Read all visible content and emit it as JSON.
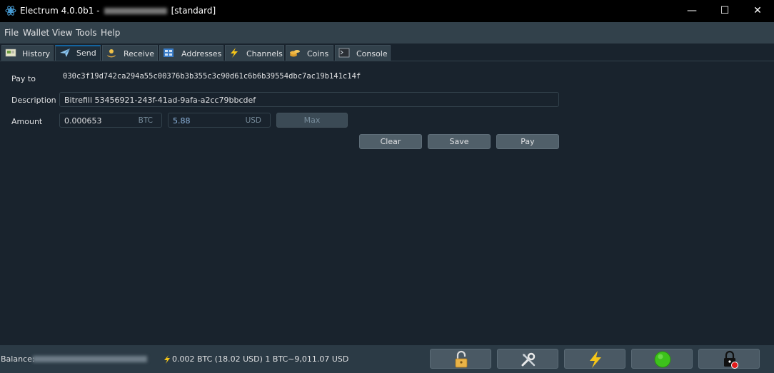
{
  "window": {
    "app_title": "Electrum 4.0.0b1  -",
    "wallet_type": "[standard]",
    "minimize": "—",
    "maximize": "☐",
    "close": "✕"
  },
  "menu": [
    "File",
    "Wallet",
    "View",
    "Tools",
    "Help"
  ],
  "tabs": [
    "History",
    "Send",
    "Receive",
    "Addresses",
    "Channels",
    "Coins",
    "Console"
  ],
  "active_tab": "Send",
  "send": {
    "payto_label": "Pay to",
    "payto_value": "030c3f19d742ca294a55c00376b3b355c3c90d61c6b6b39554dbc7ac19b141c14f",
    "description_label": "Description",
    "description_value": "Bitrefill 53456921-243f-41ad-9afa-a2cc79bbcdef",
    "amount_label": "Amount",
    "amount_btc": "0.000653",
    "amount_btc_unit": "BTC",
    "amount_fiat": "5.88",
    "amount_fiat_unit": "USD",
    "max_label": "Max",
    "clear_label": "Clear",
    "save_label": "Save",
    "pay_label": "Pay"
  },
  "status": {
    "balance_label": "Balance:",
    "lightning_balance": "0.002 BTC (18.02 USD) 1 BTC~9,011.07 USD"
  },
  "colors": {
    "background": "#19232d",
    "panel": "#32414b",
    "accent": "#1464a0",
    "fiat_text": "#8fb6e0",
    "online": "#3dc21b"
  },
  "icons": {
    "status_buttons": [
      "lock-icon",
      "tools-icon",
      "lightning-icon",
      "network-status-icon",
      "seed-icon"
    ]
  }
}
